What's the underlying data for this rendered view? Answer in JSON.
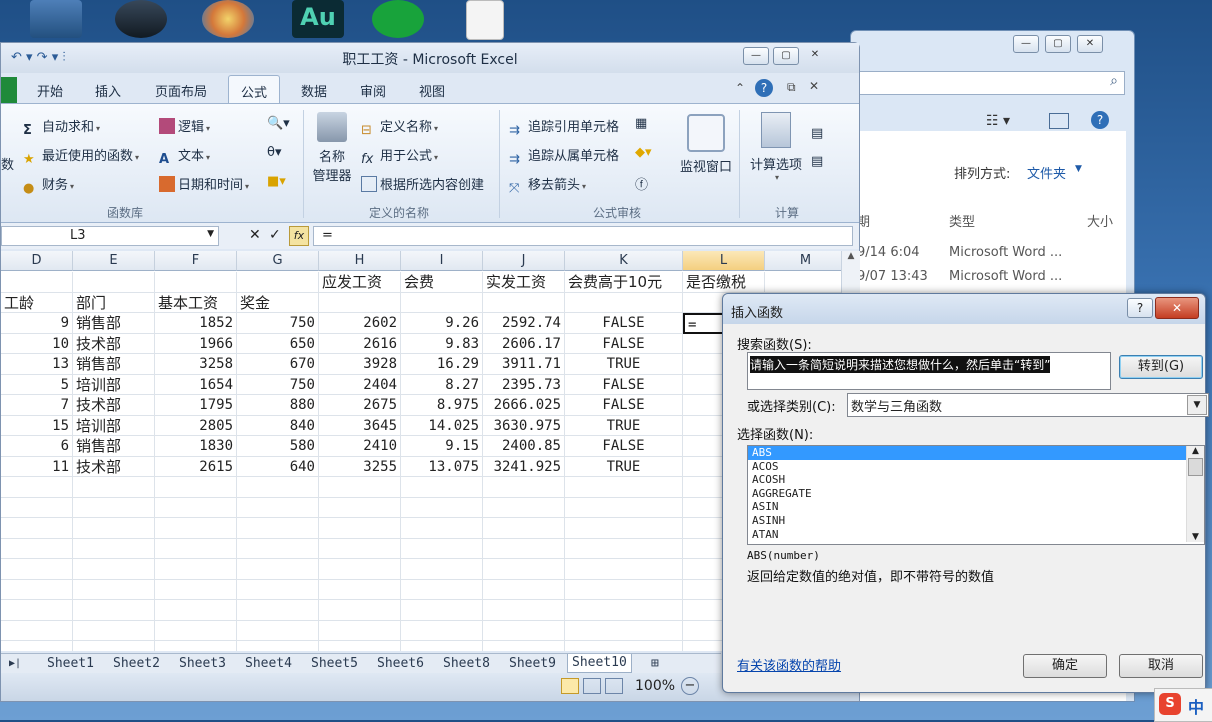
{
  "explorer": {
    "sort_label": "排列方式:",
    "sort_value": "文件夹",
    "col_date": "期",
    "col_type": "类型",
    "col_size": "大小",
    "rows": [
      {
        "date": "9/14 6:04",
        "type": "Microsoft Word ..."
      },
      {
        "date": "9/07 13:43",
        "type": "Microsoft Word ..."
      }
    ]
  },
  "excel": {
    "title": "职工工资 - Microsoft Excel",
    "tabs": [
      "开始",
      "插入",
      "页面布局",
      "公式",
      "数据",
      "审阅",
      "视图"
    ],
    "active_tab": "公式",
    "ribbon": {
      "lib": {
        "partial": "数",
        "autosum": "自动求和",
        "recent": "最近使用的函数",
        "finance": "财务",
        "logic": "逻辑",
        "text": "文本",
        "datetime": "日期和时间",
        "group": "函数库"
      },
      "names": {
        "manager_1": "名称",
        "manager_2": "管理器",
        "define": "定义名称",
        "use": "用于公式",
        "create": "根据所选内容创建",
        "group": "定义的名称"
      },
      "audit": {
        "trace_prec": "追踪引用单元格",
        "trace_dep": "追踪从属单元格",
        "remove": "移去箭头",
        "watch": "监视窗口",
        "group": "公式审核"
      },
      "calc": {
        "options": "计算选项",
        "group": "计算"
      }
    },
    "namebox": "L3",
    "fx": "fx",
    "formula": "=",
    "columns": [
      "D",
      "E",
      "F",
      "G",
      "H",
      "I",
      "J",
      "K",
      "L",
      "M"
    ],
    "header_row1": [
      "",
      "",
      "",
      "",
      "应发工资",
      "会费",
      "实发工资",
      "会费高于10元",
      "是否缴税",
      ""
    ],
    "header_row2": [
      "工龄",
      "部门",
      "基本工资",
      "奖金",
      "",
      "",
      "",
      "",
      "",
      ""
    ],
    "rows": [
      [
        "9",
        "销售部",
        "1852",
        "750",
        "2602",
        "9.26",
        "2592.74",
        "FALSE",
        "="
      ],
      [
        "10",
        "技术部",
        "1966",
        "650",
        "2616",
        "9.83",
        "2606.17",
        "FALSE",
        ""
      ],
      [
        "13",
        "销售部",
        "3258",
        "670",
        "3928",
        "16.29",
        "3911.71",
        "TRUE",
        ""
      ],
      [
        "5",
        "培训部",
        "1654",
        "750",
        "2404",
        "8.27",
        "2395.73",
        "FALSE",
        ""
      ],
      [
        "7",
        "技术部",
        "1795",
        "880",
        "2675",
        "8.975",
        "2666.025",
        "FALSE",
        ""
      ],
      [
        "15",
        "培训部",
        "2805",
        "840",
        "3645",
        "14.025",
        "3630.975",
        "TRUE",
        ""
      ],
      [
        "6",
        "销售部",
        "1830",
        "580",
        "2410",
        "9.15",
        "2400.85",
        "FALSE",
        ""
      ],
      [
        "11",
        "技术部",
        "2615",
        "640",
        "3255",
        "13.075",
        "3241.925",
        "TRUE",
        ""
      ]
    ],
    "sheets": [
      "Sheet1",
      "Sheet2",
      "Sheet3",
      "Sheet4",
      "Sheet5",
      "Sheet6",
      "Sheet8",
      "Sheet9",
      "Sheet10"
    ],
    "active_sheet": "Sheet10",
    "zoom": "100%"
  },
  "dialog": {
    "title": "插入函数",
    "search_label": "搜索函数(S):",
    "search_value": "请输入一条简短说明来描述您想做什么，然后单击“转到”",
    "go_button": "转到(G)",
    "category_label": "或选择类别(C):",
    "category_value": "数学与三角函数",
    "select_label": "选择函数(N):",
    "functions": [
      "ABS",
      "ACOS",
      "ACOSH",
      "AGGREGATE",
      "ASIN",
      "ASINH",
      "ATAN"
    ],
    "selected_function": "ABS",
    "signature": "ABS(number)",
    "description": "返回给定数值的绝对值，即不带符号的数值",
    "help_link": "有关该函数的帮助",
    "ok": "确定",
    "cancel": "取消"
  },
  "taskbar": {
    "ime": "中"
  },
  "colors": {
    "selected_item": "#3399ff",
    "ribbon_bg": "#dde7f3",
    "dialog_bg": "#f0f0f0"
  }
}
